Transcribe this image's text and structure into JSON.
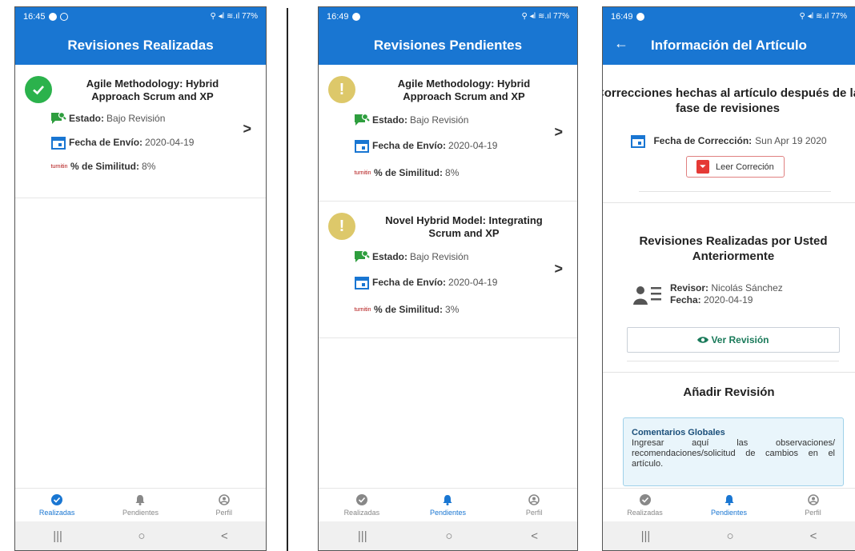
{
  "screens": [
    {
      "status_time": "16:45",
      "status_right": "⚲ ◂ǀ ≋.ıl 77%",
      "title": "Revisiones Realizadas",
      "cards": [
        {
          "title": "Agile Methodology: Hybrid Approach Scrum and XP",
          "estado_label": "Estado:",
          "estado_value": "Bajo Revisión",
          "fecha_label": "Fecha de Envío:",
          "fecha_value": "2020-04-19",
          "similitud_label": "% de Similitud:",
          "similitud_value": "8%"
        }
      ],
      "active_tab": "Realizadas"
    },
    {
      "status_time": "16:49",
      "status_right": "⚲ ◂ǀ ≋.ıl 77%",
      "title": "Revisiones Pendientes",
      "cards": [
        {
          "title": "Agile Methodology: Hybrid Approach Scrum and XP",
          "estado_label": "Estado:",
          "estado_value": "Bajo Revisión",
          "fecha_label": "Fecha de Envío:",
          "fecha_value": "2020-04-19",
          "similitud_label": "% de Similitud:",
          "similitud_value": "8%"
        },
        {
          "title": "Novel Hybrid Model: Integrating Scrum and XP",
          "estado_label": "Estado:",
          "estado_value": "Bajo Revisión",
          "fecha_label": "Fecha de Envío:",
          "fecha_value": "2020-04-19",
          "similitud_label": "% de Similitud:",
          "similitud_value": "3%"
        }
      ],
      "active_tab": "Pendientes"
    },
    {
      "status_time": "16:49",
      "status_right": "⚲ ◂ǀ ≋.ıl 77%",
      "title": "Información del Artículo",
      "back": "←",
      "correcciones_title": "Correcciones hechas al artículo después de la fase de revisiones",
      "fecha_correccion_label": "Fecha de Corrección:",
      "fecha_correccion_value": "Sun Apr 19 2020",
      "leer_correccion": "Leer Correción",
      "revisiones_title": "Revisiones Realizadas por Usted Anteriormente",
      "revisor_label": "Revisor:",
      "revisor_value": "Nicolás Sánchez",
      "fecha_label": "Fecha:",
      "fecha_value": "2020-04-19",
      "ver_revision": "Ver Revisión",
      "anadir_title": "Añadir Revisión",
      "comentarios_title": "Comentarios Globales",
      "comentarios_text": "Ingresar aquí las observaciones/ recomendaciones/solicitud de cambios en el artículo.",
      "active_tab": "Pendientes"
    }
  ],
  "nav": {
    "realizadas": "Realizadas",
    "pendientes": "Pendientes",
    "perfil": "Perfil"
  },
  "sysnav": {
    "recents": "|||",
    "home": "○",
    "back": "<"
  },
  "turnitin_label": "turnitin",
  "colors": {
    "primary": "#1976d2",
    "success": "#2bb24c",
    "warning": "#ddc86a",
    "calendar": "#1976d2",
    "estado_icon": "#2e9e3e"
  },
  "icons": [
    "check-circle-icon",
    "exclamation-circle-icon",
    "comment-search-icon",
    "calendar-icon",
    "turnitin-icon",
    "chevron-right-icon",
    "bell-icon",
    "user-circle-icon",
    "pdf-icon",
    "eye-icon",
    "user-list-icon",
    "back-arrow-icon"
  ]
}
